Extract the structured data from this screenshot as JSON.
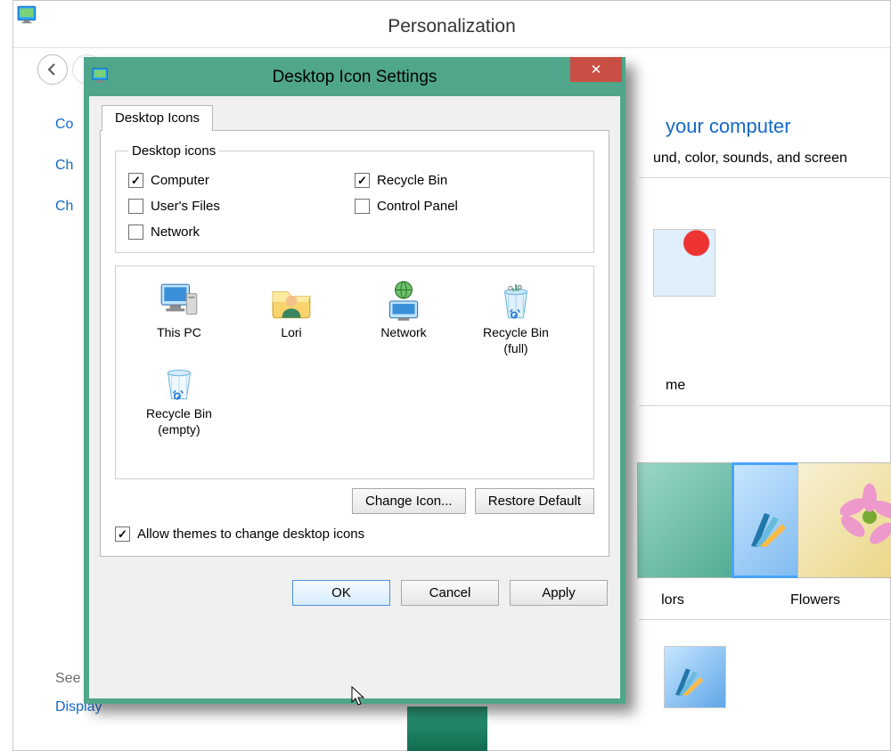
{
  "background": {
    "title": "Personalization",
    "side_links": {
      "a": "Co",
      "b": "Ch",
      "c": "Ch"
    },
    "headline_suffix": "your computer",
    "subtext_suffix": "und, color, sounds, and screen",
    "label_me": "me",
    "themes": {
      "lors": "lors",
      "flowers": "Flowers"
    },
    "see": "See",
    "display": "Display"
  },
  "dialog": {
    "title": "Desktop Icon Settings",
    "tab": "Desktop Icons",
    "group_legend": "Desktop icons",
    "checks": {
      "computer": {
        "label": "Computer",
        "checked": true
      },
      "usersfiles": {
        "label": "User's Files",
        "checked": false
      },
      "network": {
        "label": "Network",
        "checked": false
      },
      "recycle": {
        "label": "Recycle Bin",
        "checked": true
      },
      "cpanel": {
        "label": "Control Panel",
        "checked": false
      }
    },
    "preview": [
      {
        "name": "This PC"
      },
      {
        "name": "Lori"
      },
      {
        "name": "Network"
      },
      {
        "name": "Recycle Bin\n(full)"
      },
      {
        "name": "Recycle Bin\n(empty)"
      }
    ],
    "change_icon": "Change Icon...",
    "restore_default": "Restore Default",
    "allow_themes": {
      "label": "Allow themes to change desktop icons",
      "checked": true
    },
    "buttons": {
      "ok": "OK",
      "cancel": "Cancel",
      "apply": "Apply"
    }
  }
}
